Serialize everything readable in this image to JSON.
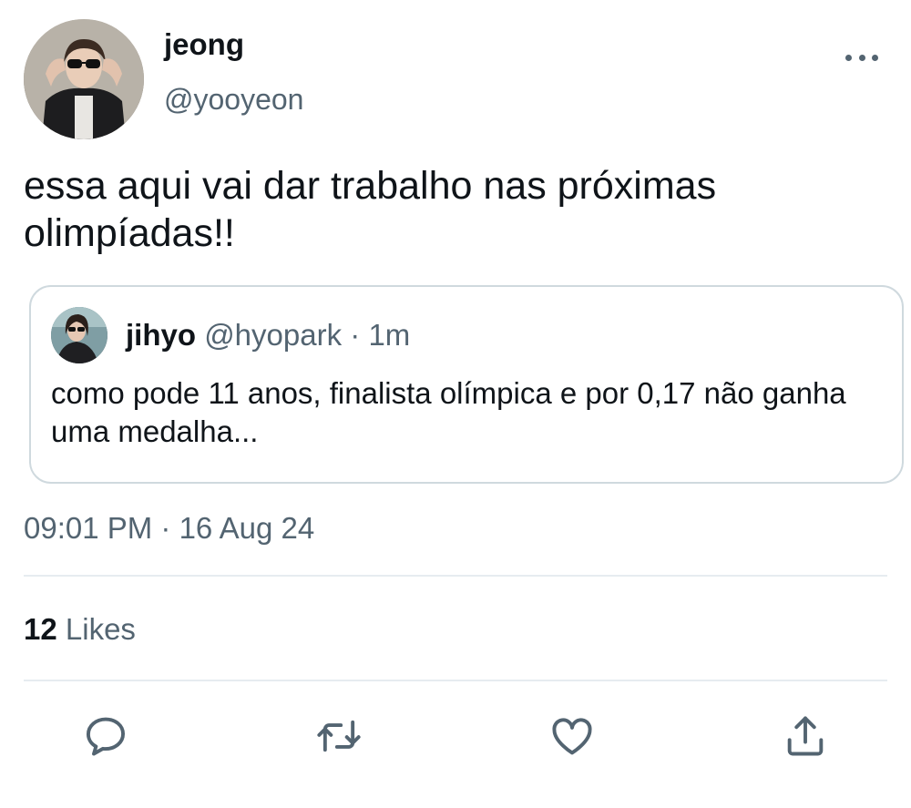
{
  "tweet": {
    "display_name": "jeong",
    "handle": "@yooyeon",
    "text": "essa aqui vai dar trabalho nas próximas\nolimpíadas!!",
    "timestamp": "09:01 PM · 16 Aug 24"
  },
  "quoted": {
    "display_name": "jihyo",
    "handle": "@hyopark",
    "separator": "·",
    "time": "1m",
    "text": "como pode 11 anos, finalista olímpica e por 0,17 não ganha uma medalha..."
  },
  "stats": {
    "likes_count": "12",
    "likes_label": "Likes"
  },
  "actions": [
    "reply-icon",
    "retweet-icon",
    "like-icon",
    "share-icon"
  ],
  "colors": {
    "text_primary": "#0f1419",
    "text_secondary": "#536471",
    "border": "#cfd9de"
  }
}
